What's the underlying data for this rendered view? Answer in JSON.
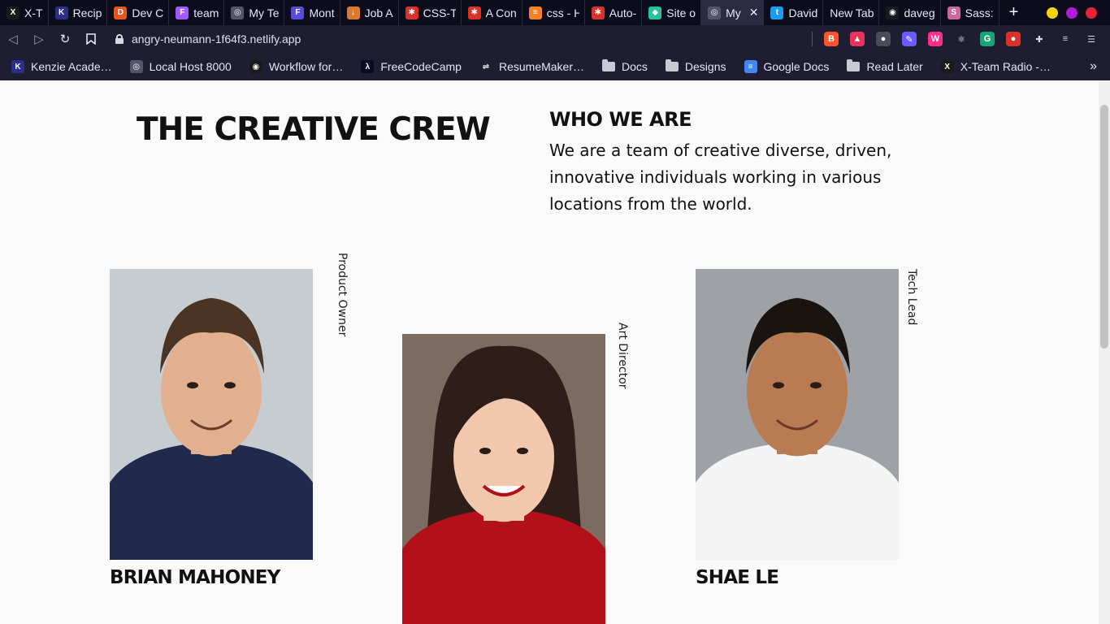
{
  "browser": {
    "tabs": [
      {
        "label": "X-T",
        "color": "#1a1a1a",
        "glyph": "X"
      },
      {
        "label": "Recip",
        "color": "#2a2f8a",
        "glyph": "K"
      },
      {
        "label": "Dev C",
        "color": "#e8541e",
        "glyph": "D"
      },
      {
        "label": "team",
        "color": "#a259ff",
        "glyph": "F"
      },
      {
        "label": "My Te",
        "color": "#55546a",
        "glyph": "◎"
      },
      {
        "label": "Mont",
        "color": "#5b4bdb",
        "glyph": "F"
      },
      {
        "label": "Job A",
        "color": "#d9792b",
        "glyph": "↓"
      },
      {
        "label": "CSS-T",
        "color": "#d9322b",
        "glyph": "✱"
      },
      {
        "label": "A Con",
        "color": "#d9322b",
        "glyph": "✱"
      },
      {
        "label": "css - H",
        "color": "#f48024",
        "glyph": "≡"
      },
      {
        "label": "Auto-",
        "color": "#d9322b",
        "glyph": "✱"
      },
      {
        "label": "Site o",
        "color": "#25c2a0",
        "glyph": "◆"
      },
      {
        "label": "My",
        "color": "#55546a",
        "glyph": "◎"
      },
      {
        "label": "David",
        "color": "#1d9bf0",
        "glyph": "t"
      },
      {
        "label": "New Tab",
        "color": "",
        "glyph": ""
      },
      {
        "label": "daveg",
        "color": "#1a1a1a",
        "glyph": "◉"
      },
      {
        "label": "Sass:",
        "color": "#cd6799",
        "glyph": "S"
      }
    ],
    "url": "angry-neumann-1f64f3.netlify.app",
    "bookmarks": [
      {
        "label": "Kenzie Acade…",
        "type": "site",
        "color": "#2a2f8a",
        "glyph": "K"
      },
      {
        "label": "Local Host 8000",
        "type": "site",
        "color": "#55546a",
        "glyph": "◎"
      },
      {
        "label": "Workflow for…",
        "type": "site",
        "color": "#1a1a1a",
        "glyph": "◉"
      },
      {
        "label": "FreeCodeCamp",
        "type": "site",
        "color": "#0a0a23",
        "glyph": "λ"
      },
      {
        "label": "ResumeMaker…",
        "type": "site",
        "color": "#1e1d32",
        "glyph": "⇌"
      },
      {
        "label": "Docs",
        "type": "folder"
      },
      {
        "label": "Designs",
        "type": "folder"
      },
      {
        "label": "Google Docs",
        "type": "site",
        "color": "#4285f4",
        "glyph": "≡"
      },
      {
        "label": "Read Later",
        "type": "folder"
      },
      {
        "label": "X-Team Radio -…",
        "type": "site",
        "color": "#1a1a1a",
        "glyph": "X"
      }
    ],
    "bookmarks_more": "»",
    "extensions": [
      {
        "name": "brave-shield-icon",
        "color": "#fb542b",
        "glyph": "B"
      },
      {
        "name": "brave-rewards-icon",
        "color": "#e8345a",
        "glyph": "▲"
      },
      {
        "name": "extension-dark-icon",
        "color": "#4a4a5a",
        "glyph": "●"
      },
      {
        "name": "extension-pen-icon",
        "color": "#6b5bff",
        "glyph": "✎"
      },
      {
        "name": "extension-w-icon",
        "color": "#ff2e8a",
        "glyph": "W"
      },
      {
        "name": "react-devtools-icon",
        "color": "#1e1d32",
        "glyph": "⚛"
      },
      {
        "name": "extension-green-icon",
        "color": "#1aa37a",
        "glyph": "G"
      },
      {
        "name": "extension-tomato-icon",
        "color": "#d9322b",
        "glyph": "●"
      }
    ]
  },
  "hero": {
    "title": "THE CREATIVE CREW",
    "who_heading": "WHO WE ARE",
    "who_text": "We are a team of creative diverse, driven, innovative individuals working in various locations from the world."
  },
  "team": [
    {
      "name": "BRIAN MAHONEY",
      "role": "Product Owner",
      "skin": "#e2b08f",
      "hair": "#4b3424",
      "shirt": "#1f2a4d",
      "bg": "#c7ccd0"
    },
    {
      "name": "",
      "role": "Art Director",
      "skin": "#f1c7ae",
      "hair": "#2e1d18",
      "shirt": "#b3101a",
      "bg": "#7d6a60"
    },
    {
      "name": "SHAE LE",
      "role": "Tech Lead",
      "skin": "#b97b52",
      "hair": "#1a1410",
      "shirt": "#f4f4f4",
      "bg": "#9ea1a6"
    }
  ]
}
